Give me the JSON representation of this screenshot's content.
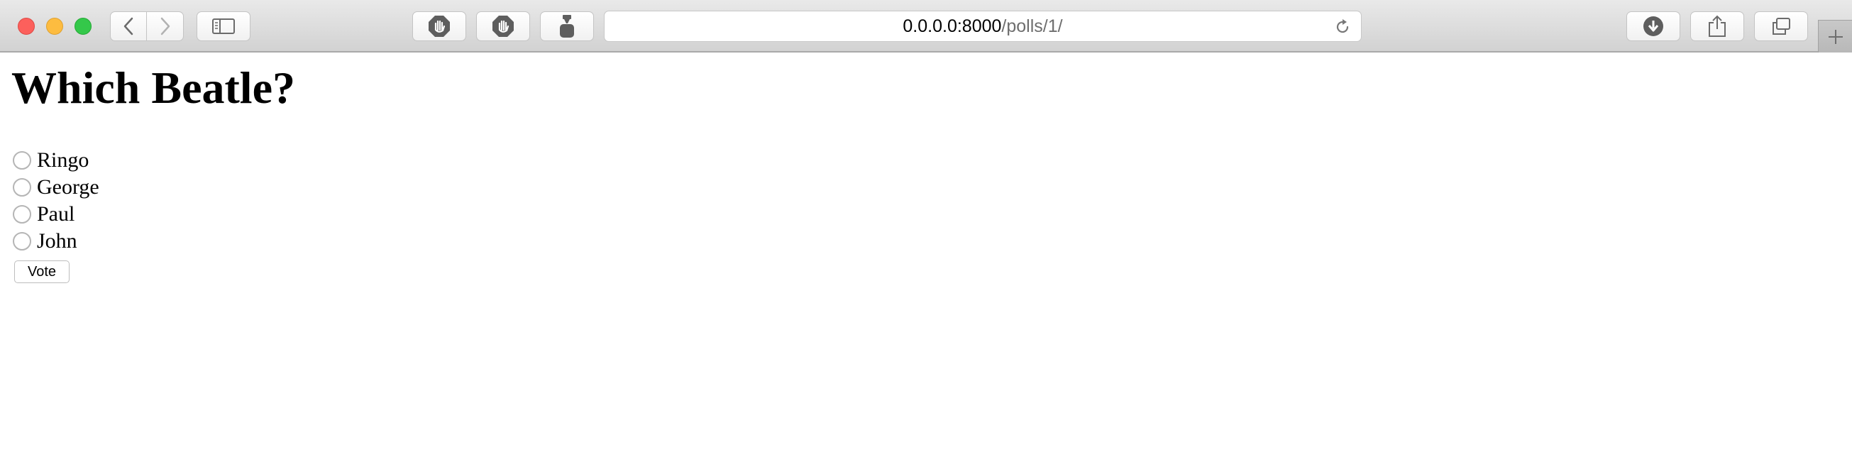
{
  "browser": {
    "url_host": "0.0.0.0:8000",
    "url_path": "/polls/1/",
    "toolbar_icons": {
      "back": "chevron-left-icon",
      "forward": "chevron-right-icon",
      "sidebar": "sidebar-icon",
      "extension_1": "stop-hand-icon",
      "extension_2": "stop-hand-icon",
      "extension_3": "extension-icon",
      "reload": "reload-icon",
      "downloads": "download-icon",
      "share": "share-icon",
      "tabs": "tabs-overview-icon",
      "new_tab": "plus-icon"
    },
    "colors": {
      "close": "#fc605c",
      "minimize": "#fdbc40",
      "maximize": "#34c84a"
    }
  },
  "poll": {
    "question": "Which Beatle?",
    "choices": [
      {
        "label": "Ringo"
      },
      {
        "label": "George"
      },
      {
        "label": "Paul"
      },
      {
        "label": "John"
      }
    ],
    "submit_label": "Vote"
  }
}
